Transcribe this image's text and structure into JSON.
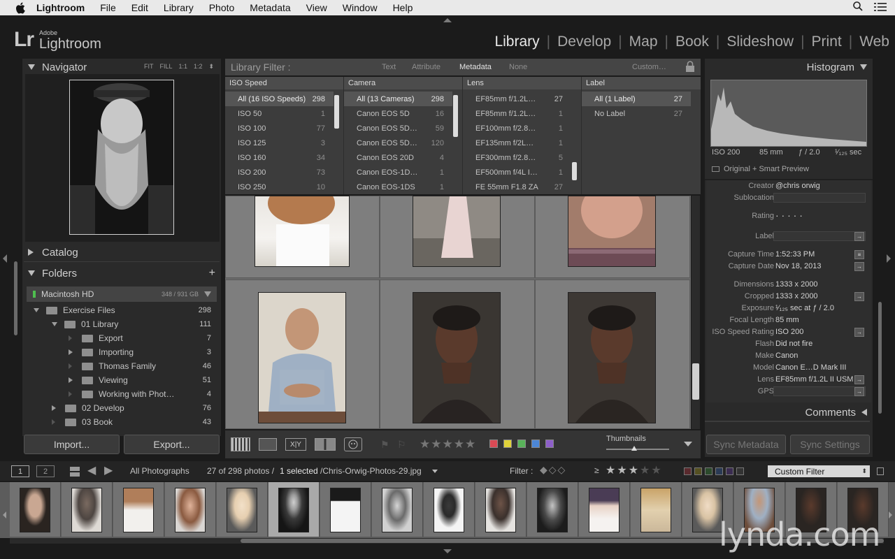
{
  "menubar": {
    "app": "Lightroom",
    "items": [
      "File",
      "Edit",
      "Library",
      "Photo",
      "Metadata",
      "View",
      "Window",
      "Help"
    ]
  },
  "identity": {
    "adobe": "Adobe",
    "name": "Lightroom",
    "lr": "Lr"
  },
  "modules": [
    "Library",
    "Develop",
    "Map",
    "Book",
    "Slideshow",
    "Print",
    "Web"
  ],
  "navigator": {
    "title": "Navigator",
    "zoom": [
      "FIT",
      "FILL",
      "1:1",
      "1:2"
    ]
  },
  "catalog": {
    "title": "Catalog"
  },
  "folders": {
    "title": "Folders",
    "volume": {
      "name": "Macintosh HD",
      "size": "348 / 931 GB"
    },
    "rows": [
      {
        "name": "Exercise Files",
        "count": "298"
      },
      {
        "name": "01 Library",
        "count": "111"
      },
      {
        "name": "Export",
        "count": "7"
      },
      {
        "name": "Importing",
        "count": "3"
      },
      {
        "name": "Thomas Family",
        "count": "46"
      },
      {
        "name": "Viewing",
        "count": "51"
      },
      {
        "name": "Working with Phot…",
        "count": "4"
      },
      {
        "name": "02 Develop",
        "count": "76"
      },
      {
        "name": "03 Book",
        "count": "43"
      }
    ]
  },
  "buttons": {
    "import": "Import...",
    "export": "Export..."
  },
  "library_filter": {
    "label": "Library Filter :",
    "modes": [
      "Text",
      "Attribute",
      "Metadata",
      "None"
    ],
    "preset": "Custom…",
    "columns": [
      {
        "header": "ISO Speed",
        "rows": [
          [
            "All (16 ISO Speeds)",
            "298"
          ],
          [
            "ISO 50",
            "1"
          ],
          [
            "ISO 100",
            "77"
          ],
          [
            "ISO 125",
            "3"
          ],
          [
            "ISO 160",
            "34"
          ],
          [
            "ISO 200",
            "73"
          ],
          [
            "ISO 250",
            "10"
          ]
        ]
      },
      {
        "header": "Camera",
        "rows": [
          [
            "All (13 Cameras)",
            "298"
          ],
          [
            "Canon EOS 5D",
            "16"
          ],
          [
            "Canon EOS 5D…",
            "59"
          ],
          [
            "Canon EOS 5D…",
            "120"
          ],
          [
            "Canon EOS 20D",
            "4"
          ],
          [
            "Canon EOS-1D…",
            "1"
          ],
          [
            "Canon EOS-1DS",
            "1"
          ]
        ]
      },
      {
        "header": "Lens",
        "rows": [
          [
            "EF85mm f/1.2L…",
            "27"
          ],
          [
            "EF85mm f/1.2L…",
            "1"
          ],
          [
            "EF100mm f/2.8…",
            "1"
          ],
          [
            "EF135mm f/2L…",
            "1"
          ],
          [
            "EF300mm f/2.8…",
            "5"
          ],
          [
            "EF500mm f/4L I…",
            "1"
          ],
          [
            "FE 55mm F1.8 ZA",
            "27"
          ]
        ]
      },
      {
        "header": "Label",
        "rows": [
          [
            "All (1 Label)",
            "27"
          ],
          [
            "No Label",
            "27"
          ]
        ]
      }
    ]
  },
  "histogram": {
    "title": "Histogram",
    "iso": "ISO 200",
    "focal": "85 mm",
    "aperture": "ƒ / 2.0",
    "shutter": "¹⁄₁₂₅ sec",
    "preview": "Original + Smart Preview"
  },
  "metadata": [
    {
      "label": "Creator",
      "value": "@chris orwig"
    },
    {
      "label": "Sublocation",
      "value": ""
    },
    {
      "label": "Rating",
      "value": "·  ·  ·  ·  ·"
    },
    {
      "label": "Label",
      "value": ""
    },
    {
      "label": "Capture Time",
      "value": "1:52:33 PM"
    },
    {
      "label": "Capture Date",
      "value": "Nov 18, 2013"
    },
    {
      "label": "Dimensions",
      "value": "1333 x 2000"
    },
    {
      "label": "Cropped",
      "value": "1333 x 2000"
    },
    {
      "label": "Exposure",
      "value": "¹⁄₁₂₅ sec at ƒ / 2.0"
    },
    {
      "label": "Focal Length",
      "value": "85 mm"
    },
    {
      "label": "ISO Speed Rating",
      "value": "ISO 200"
    },
    {
      "label": "Flash",
      "value": "Did not fire"
    },
    {
      "label": "Make",
      "value": "Canon"
    },
    {
      "label": "Model",
      "value": "Canon E…D Mark III"
    },
    {
      "label": "Lens",
      "value": "EF85mm f/1.2L II USM"
    },
    {
      "label": "GPS",
      "value": ""
    }
  ],
  "comments": {
    "title": "Comments"
  },
  "sync": {
    "metadata": "Sync Metadata",
    "settings": "Sync Settings"
  },
  "toolbar": {
    "thumbnails_label": "Thumbnails",
    "colors": [
      "#d94a55",
      "#e0d23a",
      "#59b25a",
      "#4c86d6",
      "#8d5fc9"
    ]
  },
  "filmstrip_bar": {
    "screen1": "1",
    "screen2": "2",
    "source": "All Photographs",
    "count": "27 of 298 photos /",
    "selected": "1 selected",
    "file": "/Chris-Orwig-Photos-29.jpg",
    "filter_label": "Filter :",
    "ge": "≥",
    "custom_filter": "Custom Filter"
  },
  "watermark": "lynda.com"
}
